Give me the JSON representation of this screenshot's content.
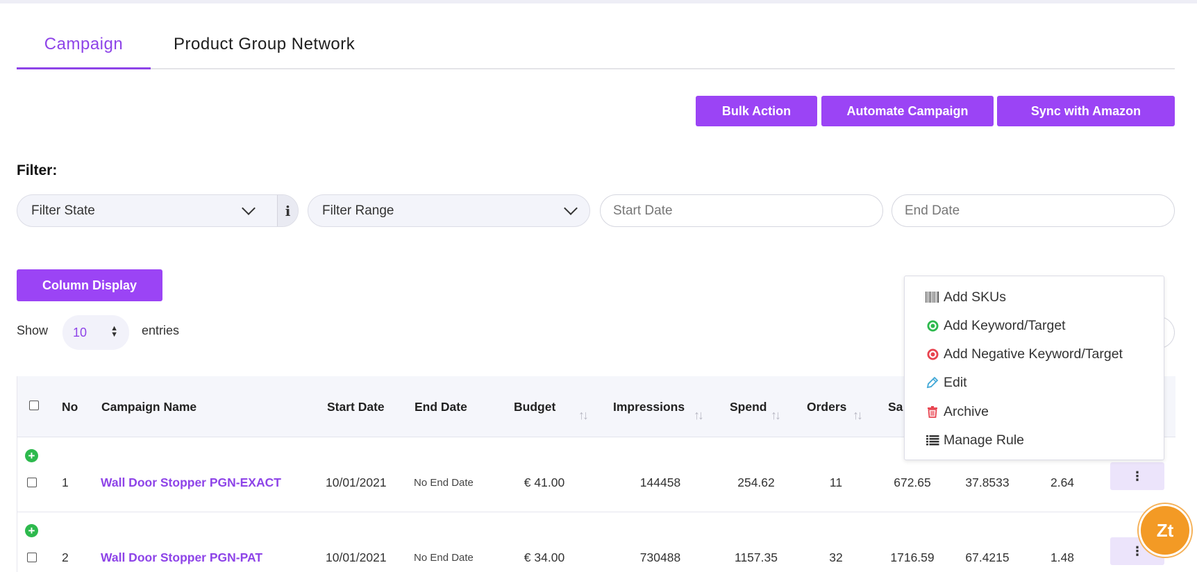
{
  "tabs": [
    {
      "label": "Campaign",
      "active": true
    },
    {
      "label": "Product Group Network",
      "active": false
    }
  ],
  "actions": {
    "bulk_action": "Bulk Action",
    "automate_campaign": "Automate Campaign",
    "sync_amazon": "Sync with Amazon"
  },
  "filter": {
    "label": "Filter:",
    "state_value": "Filter State",
    "range_value": "Filter Range",
    "start_placeholder": "Start Date",
    "end_placeholder": "End Date",
    "info_glyph": "i"
  },
  "column_display": "Column Display",
  "pagination": {
    "show_label": "Show",
    "entries_value": "10",
    "entries_label": "entries"
  },
  "table": {
    "headers": {
      "no": "No",
      "campaign_name": "Campaign Name",
      "start_date": "Start Date",
      "end_date": "End Date",
      "budget": "Budget",
      "impressions": "Impressions",
      "spend": "Spend",
      "orders": "Orders",
      "sales": "Sa"
    },
    "rows": [
      {
        "no": "1",
        "name": "Wall Door Stopper PGN-EXACT",
        "start": "10/01/2021",
        "end": "No End Date",
        "budget": "€ 41.00",
        "impressions": "144458",
        "spend": "254.62",
        "orders": "11",
        "sales": "672.65",
        "col10": "37.8533",
        "col11": "2.64"
      },
      {
        "no": "2",
        "name": "Wall Door Stopper PGN-PAT",
        "start": "10/01/2021",
        "end": "No End Date",
        "budget": "€ 34.00",
        "impressions": "730488",
        "spend": "1157.35",
        "orders": "32",
        "sales": "1716.59",
        "col10": "67.4215",
        "col11": "1.48"
      }
    ]
  },
  "context_menu": [
    {
      "label": "Add SKUs",
      "icon": "barcode-icon"
    },
    {
      "label": "Add Keyword/Target",
      "icon": "target-green-icon"
    },
    {
      "label": "Add Negative Keyword/Target",
      "icon": "target-red-icon"
    },
    {
      "label": "Edit",
      "icon": "pencil-icon"
    },
    {
      "label": "Archive",
      "icon": "trash-icon"
    },
    {
      "label": "Manage Rule",
      "icon": "list-icon"
    }
  ],
  "colors": {
    "accent": "#9b44f5",
    "link": "#8e44e8",
    "add_green": "#2db94d",
    "chat_orange": "#f39a25"
  },
  "chat_widget": {
    "label": "Zt"
  }
}
